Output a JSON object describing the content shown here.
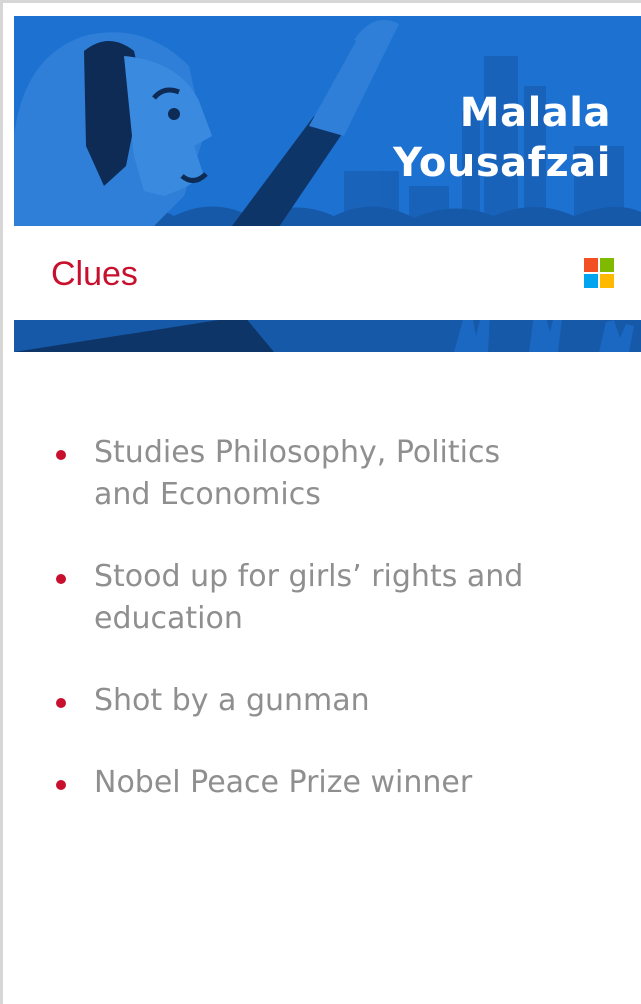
{
  "title": {
    "line1": "Malala",
    "line2": "Yousafzai"
  },
  "header": {
    "clues_label": "Clues",
    "logo_icon": "microsoft-logo-icon"
  },
  "clues": [
    {
      "line1": "Studies Philosophy, Politics",
      "line2": "and Economics"
    },
    {
      "line1": "Stood up for girls’ rights and",
      "line2": "education"
    },
    {
      "line1": "Shot by a gunman",
      "line2": ""
    },
    {
      "line1": "Nobel Peace Prize winner",
      "line2": ""
    }
  ],
  "colors": {
    "hero_blue": "#1d72d1",
    "accent_red": "#c8102e",
    "clue_text_gray": "#8f8f8f"
  }
}
